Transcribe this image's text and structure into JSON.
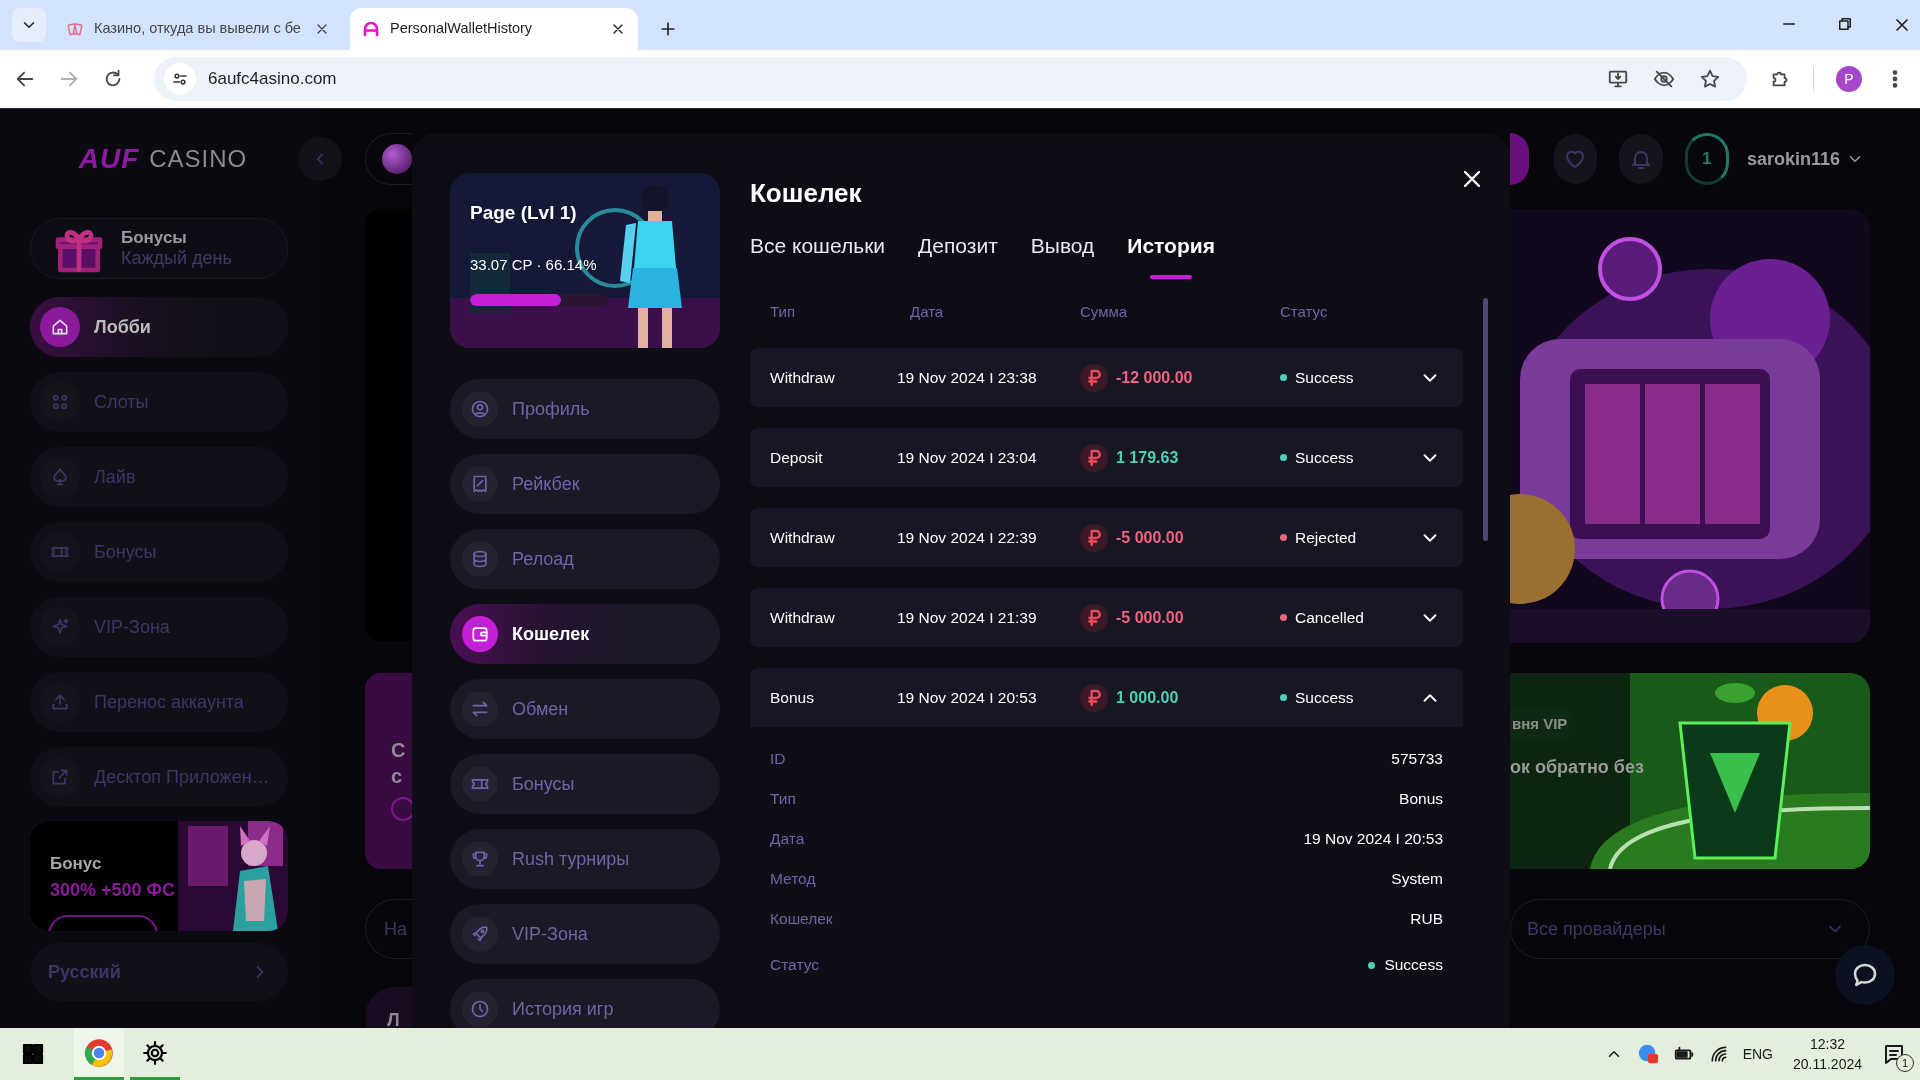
{
  "browser": {
    "tabs": [
      {
        "title": "Казино, откуда вы вывели с бе",
        "selected": false
      },
      {
        "title": "PersonalWalletHistory",
        "selected": true
      }
    ],
    "url": "6aufc4asino.com",
    "profile_initial": "P"
  },
  "sidebar": {
    "logo_brand": "AUF",
    "logo_word": "CASINO",
    "daily": {
      "title": "Бонусы",
      "subtitle": "Каждый день"
    },
    "items": [
      {
        "label": "Лобби",
        "selected": true
      },
      {
        "label": "Слоты",
        "selected": false
      },
      {
        "label": "Лайв",
        "selected": false
      },
      {
        "label": "Бонусы",
        "selected": false
      },
      {
        "label": "VIP-Зона",
        "selected": false
      },
      {
        "label": "Перенос аккаунта",
        "selected": false
      },
      {
        "label": "Десктоп Приложен…",
        "selected": false
      }
    ],
    "promo": {
      "title": "Бонус",
      "offer": "300% +500 ФС"
    },
    "language": "Русский"
  },
  "header": {
    "level_number": "1",
    "username": "sarokin116"
  },
  "background": {
    "card_lines": [
      "С",
      "с"
    ],
    "search_text": "На",
    "bottom_text": "Л",
    "vip_badge": "вня VIP",
    "vip_text": "ок обратно без",
    "providers": "Все провайдеры"
  },
  "modal": {
    "profile": {
      "name": "Page (Lvl 1)",
      "progress_text": "33.07 CP · 66.14%",
      "level": 0.66
    },
    "menu": [
      {
        "label": "Профиль",
        "selected": false
      },
      {
        "label": "Рейкбек",
        "selected": false
      },
      {
        "label": "Релоад",
        "selected": false
      },
      {
        "label": "Кошелек",
        "selected": true
      },
      {
        "label": "Обмен",
        "selected": false
      },
      {
        "label": "Бонусы",
        "selected": false
      },
      {
        "label": "Rush турниры",
        "selected": false
      },
      {
        "label": "VIP-Зона",
        "selected": false
      },
      {
        "label": "История игр",
        "selected": false
      }
    ],
    "title": "Кошелек",
    "tabs": [
      {
        "label": "Все кошельки",
        "selected": false
      },
      {
        "label": "Депозит",
        "selected": false
      },
      {
        "label": "Вывод",
        "selected": false
      },
      {
        "label": "История",
        "selected": true
      }
    ],
    "columns": [
      "Тип",
      "Дата",
      "Сумма",
      "Статус"
    ],
    "rows": [
      {
        "type": "Withdraw",
        "date": "19 Nov 2024 I 23:38",
        "amount": "-12 000.00",
        "kind": "debit",
        "status": "Success",
        "color": "#4fd1b5",
        "expanded": false
      },
      {
        "type": "Deposit",
        "date": "19 Nov 2024 I 23:04",
        "amount": "1 179.63",
        "kind": "credit",
        "status": "Success",
        "color": "#4fd1b5",
        "expanded": false
      },
      {
        "type": "Withdraw",
        "date": "19 Nov 2024 I 22:39",
        "amount": "-5 000.00",
        "kind": "debit",
        "status": "Rejected",
        "color": "#f0647e",
        "expanded": false
      },
      {
        "type": "Withdraw",
        "date": "19 Nov 2024 I 21:39",
        "amount": "-5 000.00",
        "kind": "debit",
        "status": "Cancelled",
        "color": "#f0647e",
        "expanded": false
      },
      {
        "type": "Bonus",
        "date": "19 Nov 2024 I 20:53",
        "amount": "1 000.00",
        "kind": "credit",
        "status": "Success",
        "color": "#4fd1b5",
        "expanded": true,
        "details": [
          {
            "label": "ID",
            "value": "575733"
          },
          {
            "label": "Тип",
            "value": "Bonus"
          },
          {
            "label": "Дата",
            "value": "19 Nov 2024 I 20:53"
          },
          {
            "label": "Метод",
            "value": "System"
          },
          {
            "label": "Кошелек",
            "value": "RUB"
          },
          {
            "label": "Статус",
            "value": "Success",
            "color": "#4fd1b5"
          }
        ]
      }
    ]
  },
  "taskbar": {
    "language": "ENG",
    "time": "12:32",
    "date": "20.11.2024",
    "notification_count": "1"
  }
}
